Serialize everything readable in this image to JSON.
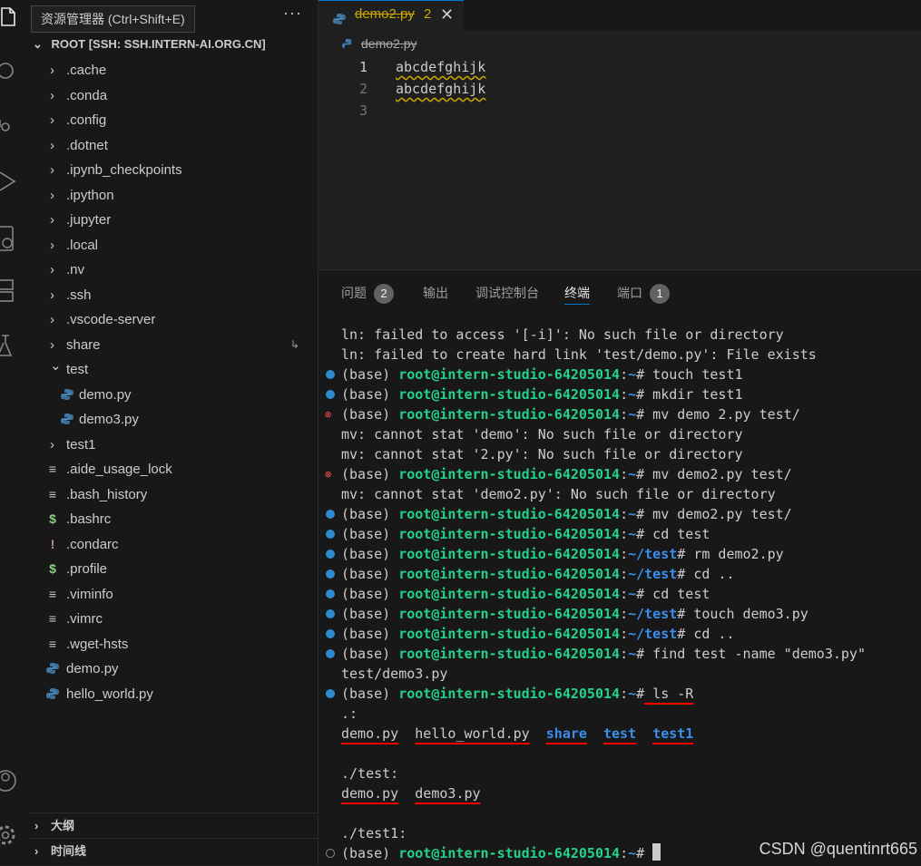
{
  "tooltip": "资源管理器 (Ctrl+Shift+E)",
  "explorer": {
    "more": "···",
    "root_title": "ROOT [SSH: SSH.INTERN-AI.ORG.CN]",
    "items": [
      {
        "label": ".cache",
        "type": "folder",
        "depth": 0,
        "open": false
      },
      {
        "label": ".conda",
        "type": "folder",
        "depth": 0,
        "open": false
      },
      {
        "label": ".config",
        "type": "folder",
        "depth": 0,
        "open": false
      },
      {
        "label": ".dotnet",
        "type": "folder",
        "depth": 0,
        "open": false
      },
      {
        "label": ".ipynb_checkpoints",
        "type": "folder",
        "depth": 0,
        "open": false
      },
      {
        "label": ".ipython",
        "type": "folder",
        "depth": 0,
        "open": false
      },
      {
        "label": ".jupyter",
        "type": "folder",
        "depth": 0,
        "open": false
      },
      {
        "label": ".local",
        "type": "folder",
        "depth": 0,
        "open": false
      },
      {
        "label": ".nv",
        "type": "folder",
        "depth": 0,
        "open": false
      },
      {
        "label": ".ssh",
        "type": "folder",
        "depth": 0,
        "open": false
      },
      {
        "label": ".vscode-server",
        "type": "folder",
        "depth": 0,
        "open": false
      },
      {
        "label": "share",
        "type": "folder",
        "depth": 0,
        "open": false,
        "symlink": true
      },
      {
        "label": "test",
        "type": "folder",
        "depth": 0,
        "open": true
      },
      {
        "label": "demo.py",
        "type": "python",
        "depth": 1
      },
      {
        "label": "demo3.py",
        "type": "python",
        "depth": 1
      },
      {
        "label": "test1",
        "type": "folder",
        "depth": 0,
        "open": false
      },
      {
        "label": ".aide_usage_lock",
        "type": "text",
        "depth": 0
      },
      {
        "label": ".bash_history",
        "type": "text",
        "depth": 0
      },
      {
        "label": ".bashrc",
        "type": "shell",
        "depth": 0
      },
      {
        "label": ".condarc",
        "type": "warn",
        "depth": 0
      },
      {
        "label": ".profile",
        "type": "shell",
        "depth": 0
      },
      {
        "label": ".viminfo",
        "type": "text",
        "depth": 0
      },
      {
        "label": ".vimrc",
        "type": "text",
        "depth": 0
      },
      {
        "label": ".wget-hsts",
        "type": "text",
        "depth": 0
      },
      {
        "label": "demo.py",
        "type": "python",
        "depth": 0
      },
      {
        "label": "hello_world.py",
        "type": "python",
        "depth": 0
      }
    ],
    "outline_label": "大纲",
    "timeline_label": "时间线"
  },
  "editor": {
    "tab_name": "demo2.py",
    "tab_problems": "2",
    "tab_close": "✕",
    "breadcrumb": "demo2.py",
    "lines": [
      {
        "num": "1",
        "text": "abcdefghijk"
      },
      {
        "num": "2",
        "text": "abcdefghijk"
      },
      {
        "num": "3",
        "text": ""
      }
    ]
  },
  "panel": {
    "tabs": [
      {
        "label": "问题",
        "badge": "2"
      },
      {
        "label": "输出",
        "badge": ""
      },
      {
        "label": "调试控制台",
        "badge": ""
      },
      {
        "label": "终端",
        "badge": ""
      },
      {
        "label": "端口",
        "badge": "1"
      }
    ],
    "active_tab": "终端"
  },
  "terminal": {
    "env": "(base)",
    "user_host": "root@intern-studio-64205014",
    "lines": [
      {
        "kind": "out",
        "text": "ln: failed to access '[-i]': No such file or directory"
      },
      {
        "kind": "out",
        "text": "ln: failed to create hard link 'test/demo.py': File exists"
      },
      {
        "kind": "cmd",
        "status": "ok",
        "path": "~",
        "cmd": " touch test1"
      },
      {
        "kind": "cmd",
        "status": "ok",
        "path": "~",
        "cmd": " mkdir test1"
      },
      {
        "kind": "cmd",
        "status": "err",
        "path": "~",
        "cmd": " mv demo 2.py test/"
      },
      {
        "kind": "out",
        "text": "mv: cannot stat 'demo': No such file or directory"
      },
      {
        "kind": "out",
        "text": "mv: cannot stat '2.py': No such file or directory"
      },
      {
        "kind": "cmd",
        "status": "err",
        "path": "~",
        "cmd": " mv demo2.py test/"
      },
      {
        "kind": "out",
        "text": "mv: cannot stat 'demo2.py': No such file or directory"
      },
      {
        "kind": "cmd",
        "status": "ok",
        "path": "~",
        "cmd": " mv demo2.py test/"
      },
      {
        "kind": "cmd",
        "status": "ok",
        "path": "~",
        "cmd": " cd test"
      },
      {
        "kind": "cmd",
        "status": "ok",
        "path": "~/test",
        "cmd": " rm demo2.py"
      },
      {
        "kind": "cmd",
        "status": "ok",
        "path": "~/test",
        "cmd": " cd .."
      },
      {
        "kind": "cmd",
        "status": "ok",
        "path": "~",
        "cmd": " cd test"
      },
      {
        "kind": "cmd",
        "status": "ok",
        "path": "~/test",
        "cmd": " touch demo3.py"
      },
      {
        "kind": "cmd",
        "status": "ok",
        "path": "~/test",
        "cmd": " cd .."
      },
      {
        "kind": "cmd",
        "status": "ok",
        "path": "~",
        "cmd": " find test -name \"demo3.py\""
      },
      {
        "kind": "out",
        "text": "test/demo3.py"
      },
      {
        "kind": "cmd",
        "status": "ok",
        "path": "~",
        "cmd": " ls -R",
        "underline_cmd": true
      },
      {
        "kind": "out",
        "text": ".:"
      },
      {
        "kind": "ls",
        "items": [
          {
            "name": "demo.py",
            "dir": false
          },
          {
            "name": "hello_world.py",
            "dir": false
          },
          {
            "name": "share",
            "dir": true
          },
          {
            "name": "test",
            "dir": true
          },
          {
            "name": "test1",
            "dir": true
          }
        ]
      },
      {
        "kind": "out",
        "text": ""
      },
      {
        "kind": "out",
        "text": "./test:"
      },
      {
        "kind": "ls",
        "items": [
          {
            "name": "demo.py",
            "dir": false
          },
          {
            "name": "demo3.py",
            "dir": false
          }
        ]
      },
      {
        "kind": "out",
        "text": ""
      },
      {
        "kind": "out",
        "text": "./test1:"
      },
      {
        "kind": "cmd",
        "status": "empty",
        "path": "~",
        "cmd": " ",
        "cursor": true
      }
    ]
  },
  "watermark": "CSDN @quentinrt665",
  "colors": {
    "accent": "#0078d4",
    "prompt_user": "#23d18b",
    "prompt_path": "#3b8eea",
    "error": "#f14c4c",
    "modified": "#cca700",
    "annotation": "#ff0000"
  }
}
